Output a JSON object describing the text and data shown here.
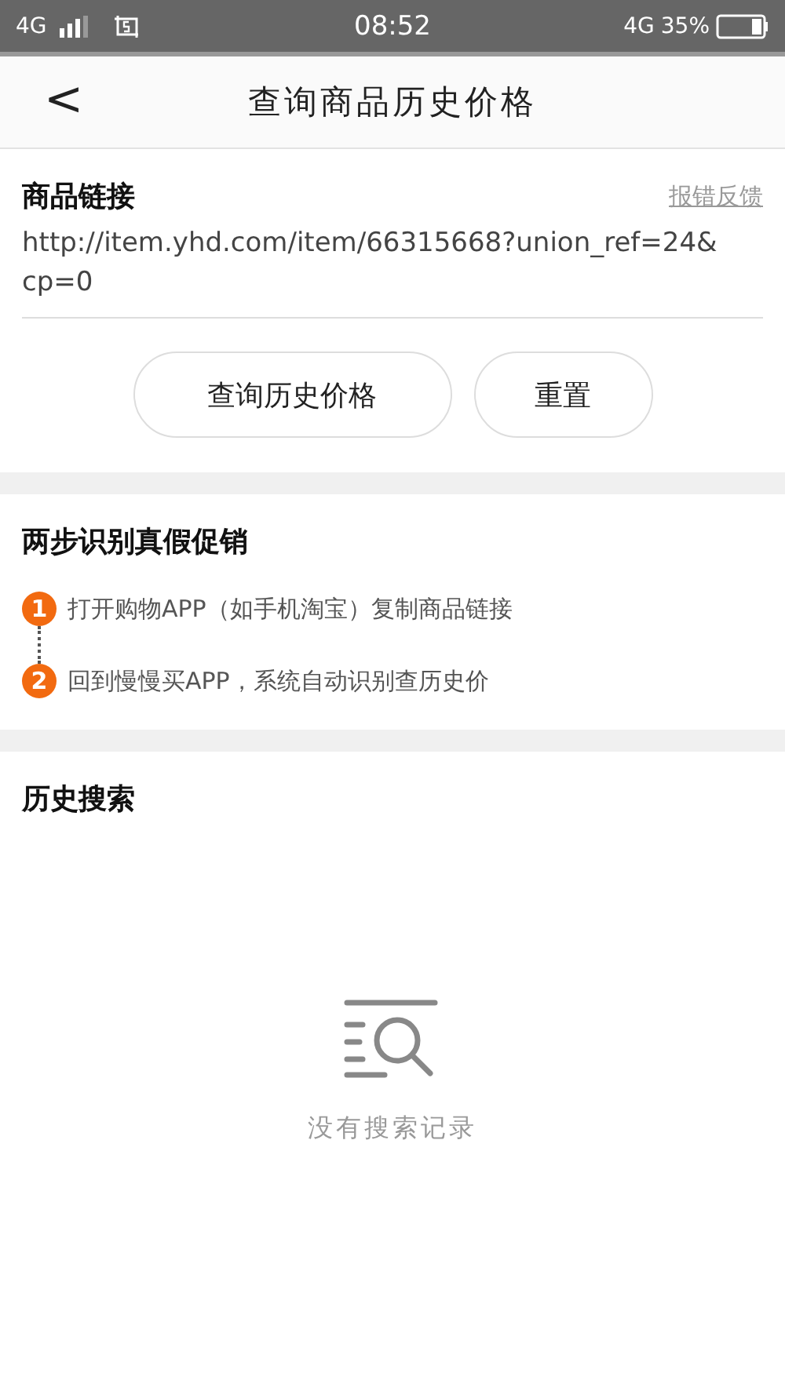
{
  "status_bar": {
    "network": "4G",
    "time": "08:52",
    "network_right": "4G",
    "battery": "35%"
  },
  "header": {
    "back": "<",
    "title": "查询商品历史价格"
  },
  "link_section": {
    "label": "商品链接",
    "feedback": "报错反馈",
    "value": "http://item.yhd.com/item/66315668?union_ref=24&cp=0",
    "buttons": [
      "查询历史价格",
      "重置"
    ]
  },
  "steps_section": {
    "title": "两步识别真假促销",
    "steps": [
      {
        "number": "1",
        "text": "打开购物APP（如手机淘宝）复制商品链接"
      },
      {
        "number": "2",
        "text": "回到慢慢买APP，系统自动识别查历史价"
      }
    ]
  },
  "history_section": {
    "title": "历史搜索",
    "empty_text": "没有搜索记录"
  }
}
